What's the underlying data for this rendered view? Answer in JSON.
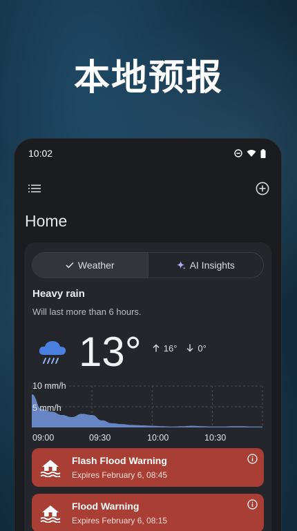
{
  "promo": {
    "headline": "本地预报"
  },
  "status_bar": {
    "time": "10:02"
  },
  "app": {
    "page_title": "Home"
  },
  "tabs": [
    {
      "label": "Weather",
      "active": true
    },
    {
      "label": "AI Insights",
      "active": false
    }
  ],
  "current": {
    "condition": "Heavy rain",
    "description": "Will last more than 6 hours.",
    "temperature": "13°",
    "high": "16°",
    "low": "0°",
    "icon": "heavy-rain-icon"
  },
  "chart_data": {
    "type": "area",
    "y_labels": [
      "10 mm/h",
      "5 mm/h"
    ],
    "x_labels": [
      "09:00",
      "09:30",
      "10:00",
      "10:30"
    ],
    "ylim": [
      0,
      10
    ],
    "x": [
      "09:00",
      "09:05",
      "09:10",
      "09:15",
      "09:20",
      "09:25",
      "09:30",
      "09:35",
      "09:40",
      "09:45",
      "09:50",
      "09:55",
      "10:00",
      "10:05",
      "10:10",
      "10:15",
      "10:20",
      "10:25",
      "10:30",
      "10:35",
      "10:40",
      "10:45",
      "10:50",
      "10:55"
    ],
    "values": [
      8,
      4.4,
      3.8,
      3.0,
      2.5,
      3.3,
      3.0,
      1.7,
      1.0,
      0.8,
      0.6,
      0.5,
      0.4,
      0.3,
      0.2,
      0.3,
      0.4,
      0.3,
      0.2,
      0.2,
      0.3,
      0.3,
      0.2,
      0.2
    ],
    "grid": true,
    "color": "#6f8fd6"
  },
  "alerts": [
    {
      "title": "Flash Flood Warning",
      "subtitle": "Expires February 6, 08:45",
      "color": "#a83e34"
    },
    {
      "title": "Flood Warning",
      "subtitle": "Expires February 6, 08:15",
      "color": "#a83e34"
    }
  ]
}
